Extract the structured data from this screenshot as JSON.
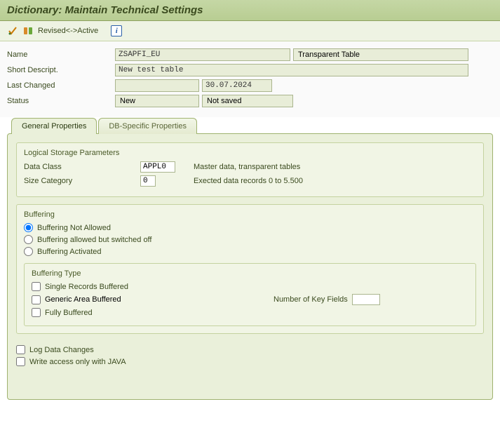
{
  "title": "Dictionary: Maintain Technical Settings",
  "toolbar": {
    "revised_active": "Revised<->Active"
  },
  "header": {
    "name_label": "Name",
    "name_value": "ZSAPFI_EU",
    "type_value": "Transparent Table",
    "short_desc_label": "Short Descript.",
    "short_desc_value": "New test table",
    "last_changed_label": "Last Changed",
    "last_changed_by": "",
    "last_changed_date": "30.07.2024",
    "status_label": "Status",
    "status_value1": "New",
    "status_value2": "Not saved"
  },
  "tabs": {
    "general": "General Properties",
    "dbspec": "DB-Specific Properties"
  },
  "storage": {
    "title": "Logical Storage Parameters",
    "data_class_label": "Data Class",
    "data_class_value": "APPL0",
    "data_class_desc": "Master data, transparent tables",
    "size_cat_label": "Size Category",
    "size_cat_value": "0",
    "size_cat_desc": "Exected data records 0 to 5.500"
  },
  "buffering": {
    "title": "Buffering",
    "opt_not_allowed": "Buffering Not Allowed",
    "opt_switched_off": "Buffering allowed but switched off",
    "opt_activated": "Buffering Activated",
    "type_title": "Buffering Type",
    "single_records": "Single Records Buffered",
    "generic_area": "Generic Area Buffered",
    "fully": "Fully Buffered",
    "num_key_fields_label": "Number of Key Fields",
    "num_key_fields_value": ""
  },
  "bottom": {
    "log_changes": "Log Data Changes",
    "write_java": "Write access only with JAVA"
  }
}
